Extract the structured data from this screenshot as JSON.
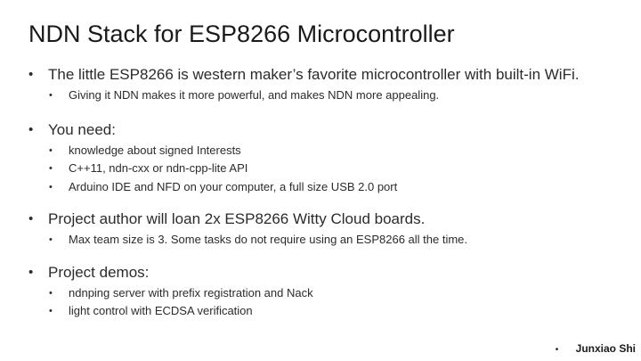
{
  "slide": {
    "title": "NDN Stack for ESP8266 Microcontroller",
    "bullet_char": "•",
    "sections": [
      {
        "text": "The little ESP8266 is western maker’s favorite microcontroller with built-in WiFi.",
        "items": [
          "Giving it NDN makes it more powerful, and makes NDN more appealing."
        ]
      },
      {
        "text": "You need:",
        "items": [
          "knowledge about signed Interests",
          "C++11, ndn-cxx or ndn-cpp-lite API",
          "Arduino IDE and NFD on your computer, a full size USB 2.0 port"
        ]
      },
      {
        "text": "Project author will loan 2x ESP8266 Witty Cloud boards.",
        "items": [
          "Max team size is 3. Some tasks do not require using an ESP8266 all the time."
        ]
      },
      {
        "text": "Project demos:",
        "items": [
          "ndnping server with prefix registration and Nack",
          "light control with ECDSA verification"
        ]
      }
    ],
    "footer": {
      "author": "Junxiao Shi"
    }
  }
}
